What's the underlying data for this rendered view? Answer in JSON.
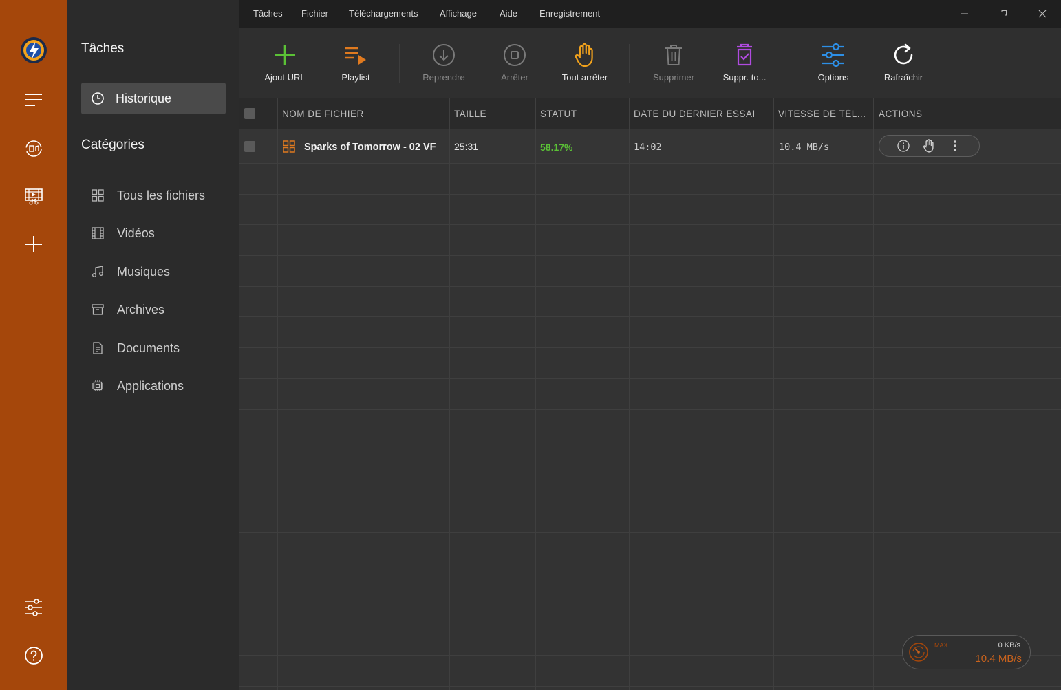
{
  "menu": [
    "Tâches",
    "Fichier",
    "Téléchargements",
    "Affichage",
    "Aide",
    "Enregistrement"
  ],
  "sidebar": {
    "title": "Tâches",
    "history_label": "Historique",
    "categories_title": "Catégories",
    "items": [
      {
        "label": "Tous les fichiers",
        "icon": "grid-icon"
      },
      {
        "label": "Vidéos",
        "icon": "film-icon"
      },
      {
        "label": "Musiques",
        "icon": "music-icon"
      },
      {
        "label": "Archives",
        "icon": "archive-icon"
      },
      {
        "label": "Documents",
        "icon": "document-icon"
      },
      {
        "label": "Applications",
        "icon": "chip-icon"
      }
    ]
  },
  "toolbar": {
    "add_url": "Ajout URL",
    "playlist": "Playlist",
    "resume": "Reprendre",
    "stop": "Arrêter",
    "stop_all": "Tout arrêter",
    "delete": "Supprimer",
    "delete_all": "Suppr. to...",
    "options": "Options",
    "refresh": "Rafraîchir"
  },
  "table": {
    "headers": [
      "NOM DE FICHIER",
      "TAILLE",
      "STATUT",
      "DATE DU DERNIER ESSAI",
      "VITESSE DE TÉL...",
      "ACTIONS"
    ],
    "rows": [
      {
        "name": "Sparks of Tomorrow - 02 VF",
        "size": "25:31",
        "status": "58.17%",
        "date": "14:02",
        "speed": "10.4 MB/s"
      }
    ]
  },
  "speed_widget": {
    "max_label": "MAX",
    "upload": "0 KB/s",
    "download": "10.4 MB/s"
  },
  "colors": {
    "rail": "#a5470b",
    "accent_orange": "#e07a1f",
    "status_green": "#5bc236",
    "options_blue": "#2d8fe6",
    "delete_all_purple": "#b04be0"
  }
}
